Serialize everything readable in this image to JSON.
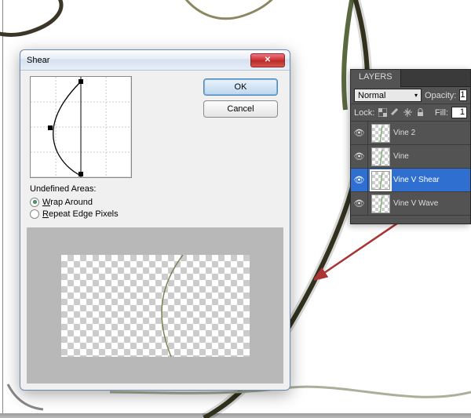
{
  "dialog": {
    "title": "Shear",
    "ok_label": "OK",
    "cancel_label": "Cancel",
    "undefined_areas_label": "Undefined Areas:",
    "wrap_around_label": "Wrap Around",
    "repeat_edge_label": "Repeat Edge Pixels",
    "selected_option": "wrap_around"
  },
  "layers_panel": {
    "tab_label": "LAYERS",
    "blend_mode": "Normal",
    "opacity_label": "Opacity:",
    "opacity_value": "1",
    "lock_label": "Lock:",
    "fill_label": "Fill:",
    "fill_value": "1",
    "layers": [
      {
        "name": "Vine 2",
        "visible": true,
        "selected": false
      },
      {
        "name": "Vine",
        "visible": true,
        "selected": false
      },
      {
        "name": "Vine V Shear",
        "visible": true,
        "selected": true
      },
      {
        "name": "Vine V Wave",
        "visible": true,
        "selected": false
      }
    ]
  },
  "icons": {
    "close_x": "✕",
    "chevron_down": "▾",
    "eye": "👁"
  }
}
